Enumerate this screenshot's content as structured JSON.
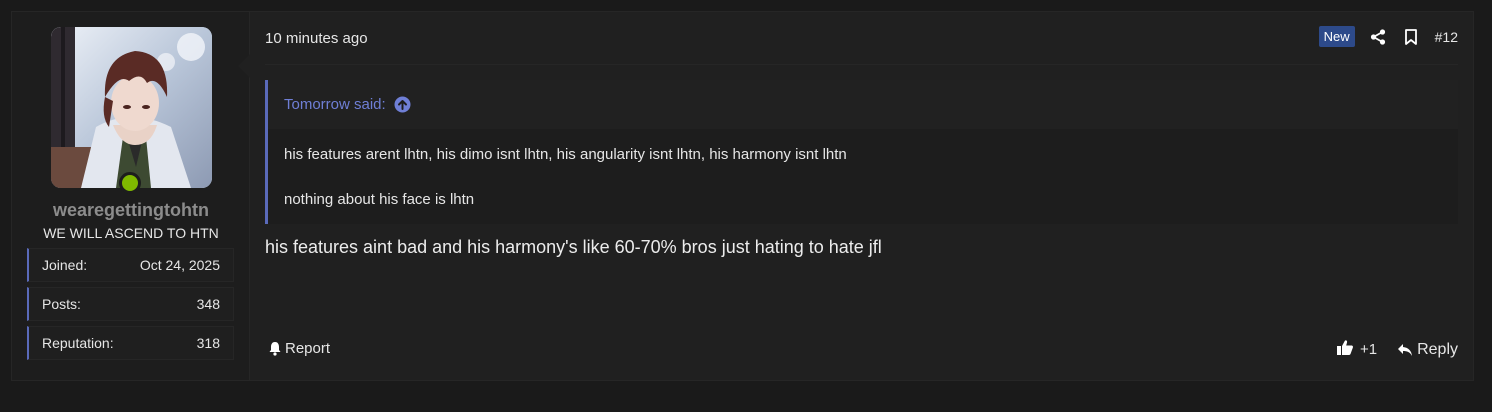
{
  "user": {
    "username": "wearegettingtohtn",
    "title": "WE WILL ASCEND TO HTN",
    "online": true,
    "stats": [
      {
        "label": "Joined:",
        "value": "Oct 24, 2025"
      },
      {
        "label": "Posts:",
        "value": "348"
      },
      {
        "label": "Reputation:",
        "value": "318"
      }
    ]
  },
  "post": {
    "timestamp": "10 minutes ago",
    "badge": "New",
    "number": "#12",
    "quote": {
      "author_line": "Tomorrow said:",
      "lines": [
        "his features arent lhtn, his dimo isnt lhtn, his angularity isnt lhtn, his harmony isnt lhtn",
        "nothing about his face is lhtn"
      ]
    },
    "body": "his features aint bad and his harmony's like 60-70% bros just hating to hate jfl",
    "report_label": "Report",
    "like_count": "+1",
    "reply_label": "Reply"
  },
  "icons": {
    "share": "share-icon",
    "bookmark": "bookmark-icon",
    "quote_jump": "arrow-up-circle-icon",
    "report": "bell-icon",
    "like": "thumbs-up-icon",
    "reply": "reply-arrow-icon"
  },
  "colors": {
    "accent": "#5a6aba",
    "quote_link": "#6f7fd6",
    "badge_bg": "#2d4a8a",
    "online": "#7fb900",
    "background": "#1a1a1a",
    "panel": "#202020"
  }
}
